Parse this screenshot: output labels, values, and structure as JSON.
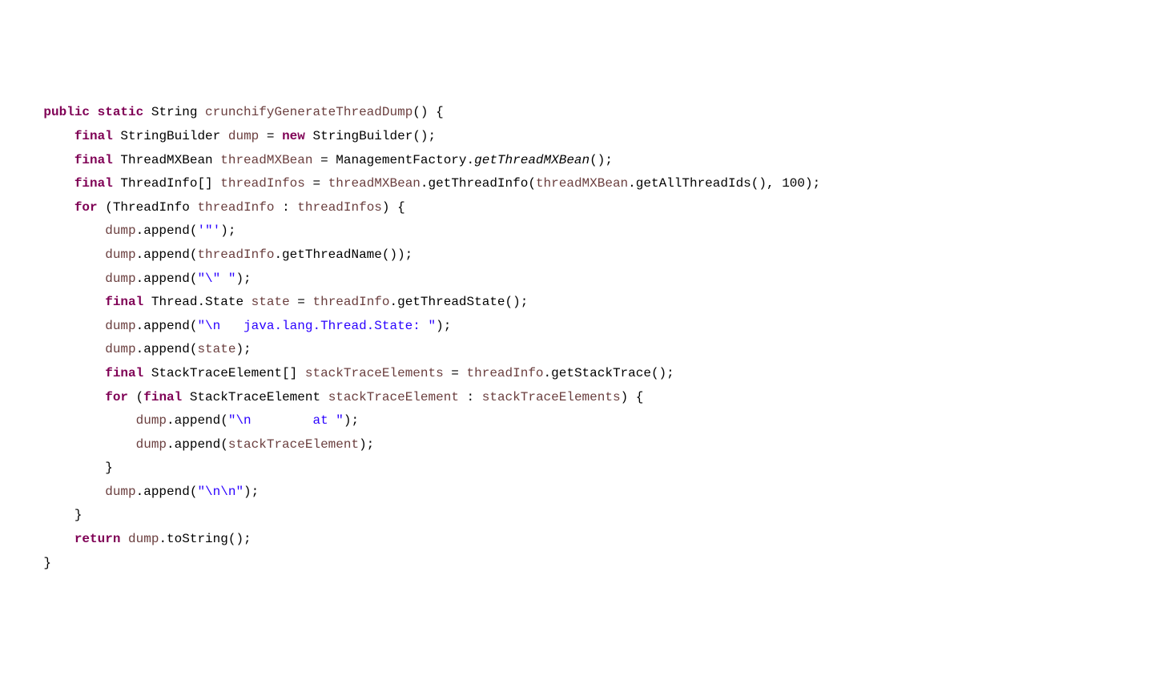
{
  "code": {
    "tokens": [
      {
        "cls": "plain",
        "t": "    "
      },
      {
        "cls": "kw",
        "t": "public"
      },
      {
        "cls": "plain",
        "t": " "
      },
      {
        "cls": "kw",
        "t": "static"
      },
      {
        "cls": "plain",
        "t": " String "
      },
      {
        "cls": "ident",
        "t": "crunchifyGenerateThreadDump"
      },
      {
        "cls": "plain",
        "t": "() {\n        "
      },
      {
        "cls": "kw",
        "t": "final"
      },
      {
        "cls": "plain",
        "t": " StringBuilder "
      },
      {
        "cls": "ident",
        "t": "dump"
      },
      {
        "cls": "plain",
        "t": " = "
      },
      {
        "cls": "kw",
        "t": "new"
      },
      {
        "cls": "plain",
        "t": " StringBuilder();\n        "
      },
      {
        "cls": "kw",
        "t": "final"
      },
      {
        "cls": "plain",
        "t": " ThreadMXBean "
      },
      {
        "cls": "ident",
        "t": "threadMXBean"
      },
      {
        "cls": "plain",
        "t": " = ManagementFactory."
      },
      {
        "cls": "methoditalic",
        "t": "getThreadMXBean"
      },
      {
        "cls": "plain",
        "t": "();\n        "
      },
      {
        "cls": "kw",
        "t": "final"
      },
      {
        "cls": "plain",
        "t": " ThreadInfo[] "
      },
      {
        "cls": "ident",
        "t": "threadInfos"
      },
      {
        "cls": "plain",
        "t": " = "
      },
      {
        "cls": "ident",
        "t": "threadMXBean"
      },
      {
        "cls": "plain",
        "t": ".getThreadInfo("
      },
      {
        "cls": "ident",
        "t": "threadMXBean"
      },
      {
        "cls": "plain",
        "t": ".getAllThreadIds(), 100);\n        "
      },
      {
        "cls": "kw",
        "t": "for"
      },
      {
        "cls": "plain",
        "t": " (ThreadInfo "
      },
      {
        "cls": "ident",
        "t": "threadInfo"
      },
      {
        "cls": "plain",
        "t": " : "
      },
      {
        "cls": "ident",
        "t": "threadInfos"
      },
      {
        "cls": "plain",
        "t": ") {\n            "
      },
      {
        "cls": "ident",
        "t": "dump"
      },
      {
        "cls": "plain",
        "t": ".append("
      },
      {
        "cls": "str",
        "t": "'\"'"
      },
      {
        "cls": "plain",
        "t": ");\n            "
      },
      {
        "cls": "ident",
        "t": "dump"
      },
      {
        "cls": "plain",
        "t": ".append("
      },
      {
        "cls": "ident",
        "t": "threadInfo"
      },
      {
        "cls": "plain",
        "t": ".getThreadName());\n            "
      },
      {
        "cls": "ident",
        "t": "dump"
      },
      {
        "cls": "plain",
        "t": ".append("
      },
      {
        "cls": "str",
        "t": "\"\\\" \""
      },
      {
        "cls": "plain",
        "t": ");\n            "
      },
      {
        "cls": "kw",
        "t": "final"
      },
      {
        "cls": "plain",
        "t": " Thread.State "
      },
      {
        "cls": "ident",
        "t": "state"
      },
      {
        "cls": "plain",
        "t": " = "
      },
      {
        "cls": "ident",
        "t": "threadInfo"
      },
      {
        "cls": "plain",
        "t": ".getThreadState();\n            "
      },
      {
        "cls": "ident",
        "t": "dump"
      },
      {
        "cls": "plain",
        "t": ".append("
      },
      {
        "cls": "str",
        "t": "\"\\n   java.lang.Thread.State: \""
      },
      {
        "cls": "plain",
        "t": ");\n            "
      },
      {
        "cls": "ident",
        "t": "dump"
      },
      {
        "cls": "plain",
        "t": ".append("
      },
      {
        "cls": "ident",
        "t": "state"
      },
      {
        "cls": "plain",
        "t": ");\n            "
      },
      {
        "cls": "kw",
        "t": "final"
      },
      {
        "cls": "plain",
        "t": " StackTraceElement[] "
      },
      {
        "cls": "ident",
        "t": "stackTraceElements"
      },
      {
        "cls": "plain",
        "t": " = "
      },
      {
        "cls": "ident",
        "t": "threadInfo"
      },
      {
        "cls": "plain",
        "t": ".getStackTrace();\n            "
      },
      {
        "cls": "kw",
        "t": "for"
      },
      {
        "cls": "plain",
        "t": " ("
      },
      {
        "cls": "kw",
        "t": "final"
      },
      {
        "cls": "plain",
        "t": " StackTraceElement "
      },
      {
        "cls": "ident",
        "t": "stackTraceElement"
      },
      {
        "cls": "plain",
        "t": " : "
      },
      {
        "cls": "ident",
        "t": "stackTraceElements"
      },
      {
        "cls": "plain",
        "t": ") {\n                "
      },
      {
        "cls": "ident",
        "t": "dump"
      },
      {
        "cls": "plain",
        "t": ".append("
      },
      {
        "cls": "str",
        "t": "\"\\n        at \""
      },
      {
        "cls": "plain",
        "t": ");\n                "
      },
      {
        "cls": "ident",
        "t": "dump"
      },
      {
        "cls": "plain",
        "t": ".append("
      },
      {
        "cls": "ident",
        "t": "stackTraceElement"
      },
      {
        "cls": "plain",
        "t": ");\n            }\n            "
      },
      {
        "cls": "ident",
        "t": "dump"
      },
      {
        "cls": "plain",
        "t": ".append("
      },
      {
        "cls": "str",
        "t": "\"\\n\\n\""
      },
      {
        "cls": "plain",
        "t": ");\n        }\n        "
      },
      {
        "cls": "kw",
        "t": "return"
      },
      {
        "cls": "plain",
        "t": " "
      },
      {
        "cls": "ident",
        "t": "dump"
      },
      {
        "cls": "plain",
        "t": ".toString();\n    }"
      }
    ]
  }
}
